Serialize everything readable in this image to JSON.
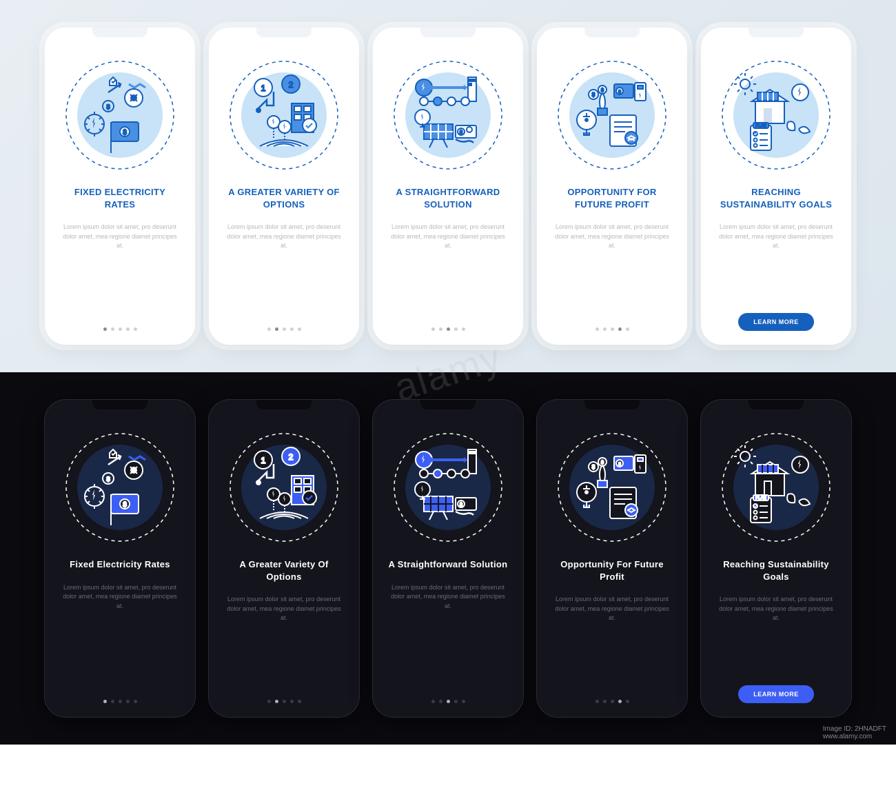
{
  "lorem": "Lorem ipsum dolor sit amet, pro deserunt dolor amet, mea regione diamet principes at.",
  "btn_label": "LEARN MORE",
  "watermark_id": "Image ID: 2HNADFT",
  "watermark_url": "www.alamy.com",
  "watermark_center": "alamy",
  "light": {
    "slides": [
      {
        "title": "FIXED ELECTRICITY RATES",
        "active": 0
      },
      {
        "title": "A GREATER VARIETY OF OPTIONS",
        "active": 1
      },
      {
        "title": "A STRAIGHTFORWARD SOLUTION",
        "active": 2
      },
      {
        "title": "OPPORTUNITY FOR FUTURE PROFIT",
        "active": 3
      },
      {
        "title": "REACHING SUSTAINABILITY GOALS",
        "active": 4,
        "cta": true
      }
    ]
  },
  "dark": {
    "slides": [
      {
        "title": "Fixed Electricity Rates",
        "active": 0
      },
      {
        "title": "A Greater Variety Of Options",
        "active": 1
      },
      {
        "title": "A Straightforward Solution",
        "active": 2
      },
      {
        "title": "Opportunity For Future Profit",
        "active": 3
      },
      {
        "title": "Reaching Sustainability Goals",
        "active": 4,
        "cta": true
      }
    ]
  },
  "colors": {
    "accent_light": "#1560bd",
    "accent_dark": "#3d5ef5",
    "illus_fill": "#4a90e2",
    "illus_stroke_light": "#1560bd",
    "illus_stroke_dark": "#ffffff"
  }
}
